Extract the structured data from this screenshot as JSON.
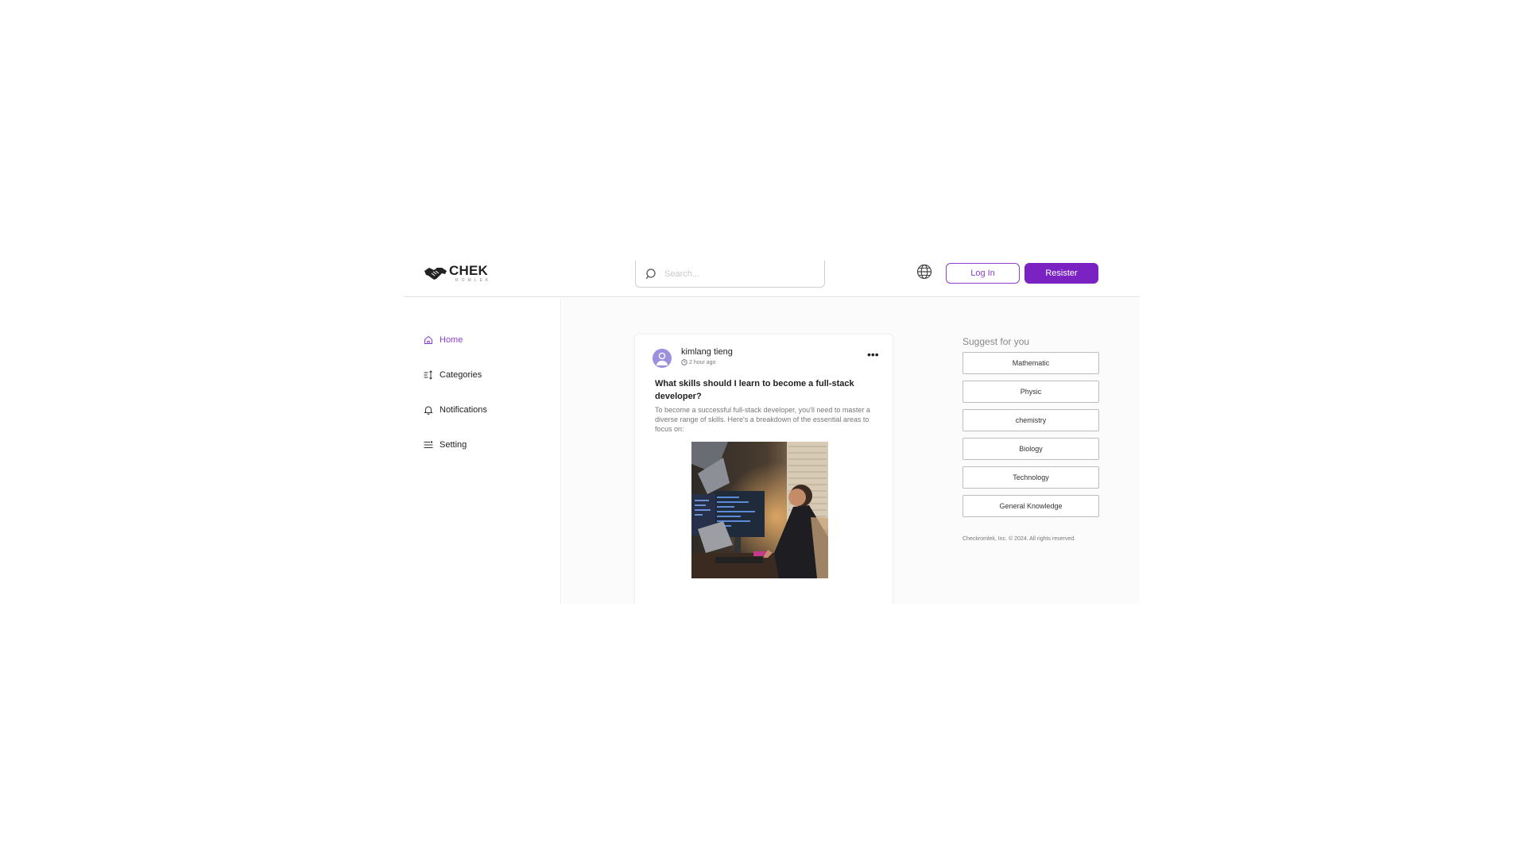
{
  "brand": {
    "name": "CHEK",
    "sub": "ROMLEK"
  },
  "search": {
    "placeholder": "Search..."
  },
  "header": {
    "login_label": "Log In",
    "register_label": "Resister"
  },
  "sidebar": {
    "items": [
      {
        "label": "Home",
        "icon": "home-icon",
        "active": true
      },
      {
        "label": "Categories",
        "icon": "categories-icon",
        "active": false
      },
      {
        "label": "Notifications",
        "icon": "bell-icon",
        "active": false
      },
      {
        "label": "Setting",
        "icon": "settings-icon",
        "active": false
      }
    ]
  },
  "post": {
    "author": "kimlang tieng",
    "time": "2 hour ago",
    "title": "What skills should I learn to become a full-stack developer?",
    "body": "To become a successful full-stack developer, you'll need to master a diverse range of skills. Here's a breakdown of the essential areas to focus on:"
  },
  "suggest": {
    "title": "Suggest for you",
    "tags": [
      "Mathematic",
      "Physic",
      "chemistry",
      "Biology",
      "Technology",
      "General Knowledge"
    ]
  },
  "footer": {
    "copyright": "Checkromlek, Inc. © 2024. All rights reserved."
  },
  "colors": {
    "accent": "#7b23c2",
    "accent_outline": "#8a3fd1",
    "avatar": "#9b8fe0"
  }
}
